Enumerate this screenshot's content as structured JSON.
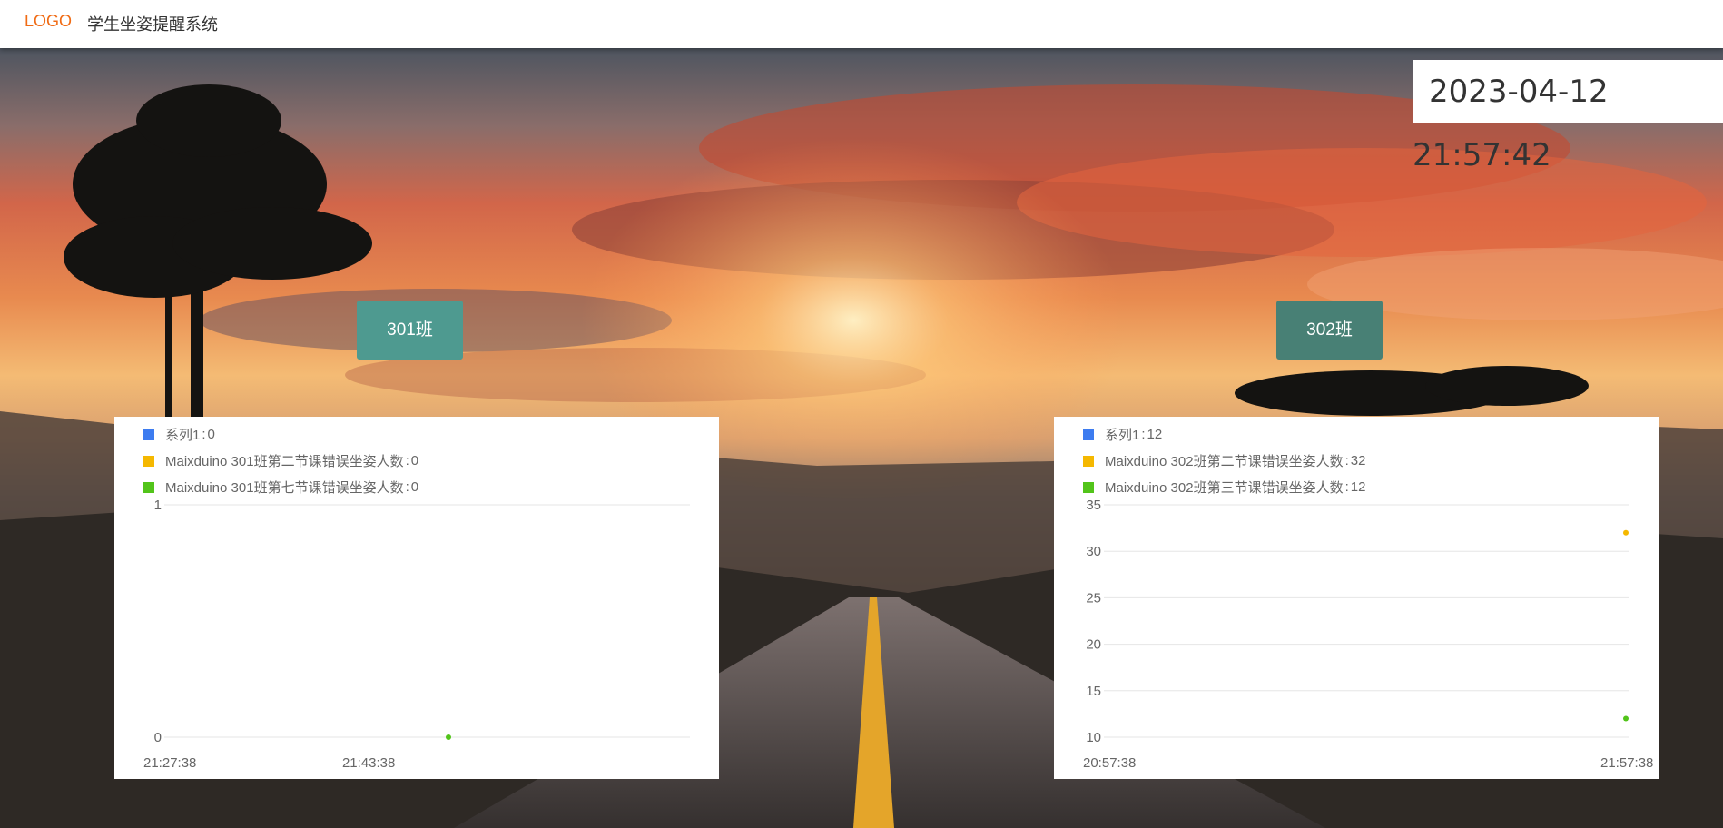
{
  "header": {
    "logo": "LOGO",
    "title": "学生坐姿提醒系统"
  },
  "clock": {
    "text": "2023-04-12 21:57:42"
  },
  "class_buttons": [
    {
      "label": "301班"
    },
    {
      "label": "302班"
    }
  ],
  "colors": {
    "accent": "#f06b14",
    "series_blue": "#3d7cf0",
    "series_yellow": "#f5b800",
    "series_green": "#52c41a",
    "button_301": "#4e9a90",
    "button_302": "#488075"
  },
  "chart_data": [
    {
      "type": "scatter",
      "legend_placement": "top-left",
      "grid": true,
      "x_ticks": [
        "21:27:38",
        "21:43:38"
      ],
      "y_ticks": [
        0,
        1
      ],
      "ylim": [
        0,
        1
      ],
      "xlim": [
        "21:27:38",
        "21:57:38"
      ],
      "series": [
        {
          "name": "系列1",
          "current": "0",
          "color": "#3d7cf0",
          "points": []
        },
        {
          "name": "Maixduino 301班第二节课错误坐姿人数",
          "current": "0",
          "color": "#f5b800",
          "points": []
        },
        {
          "name": "Maixduino 301班第七节课错误坐姿人数",
          "current": "0",
          "color": "#52c41a",
          "points": [
            {
              "x": "21:43:38",
              "y": 0
            }
          ]
        }
      ]
    },
    {
      "type": "scatter",
      "legend_placement": "top-left",
      "grid": true,
      "x_ticks": [
        "20:57:38",
        "21:57:38"
      ],
      "y_ticks": [
        10,
        15,
        20,
        25,
        30,
        35
      ],
      "ylim": [
        10,
        35
      ],
      "xlim": [
        "20:57:38",
        "21:57:38"
      ],
      "series": [
        {
          "name": "系列1",
          "current": "12",
          "color": "#3d7cf0",
          "points": []
        },
        {
          "name": "Maixduino 302班第二节课错误坐姿人数",
          "current": "32",
          "color": "#f5b800",
          "points": [
            {
              "x": "21:57:38",
              "y": 32
            }
          ]
        },
        {
          "name": "Maixduino 302班第三节课错误坐姿人数",
          "current": "12",
          "color": "#52c41a",
          "points": [
            {
              "x": "21:57:38",
              "y": 12
            }
          ]
        }
      ]
    }
  ]
}
